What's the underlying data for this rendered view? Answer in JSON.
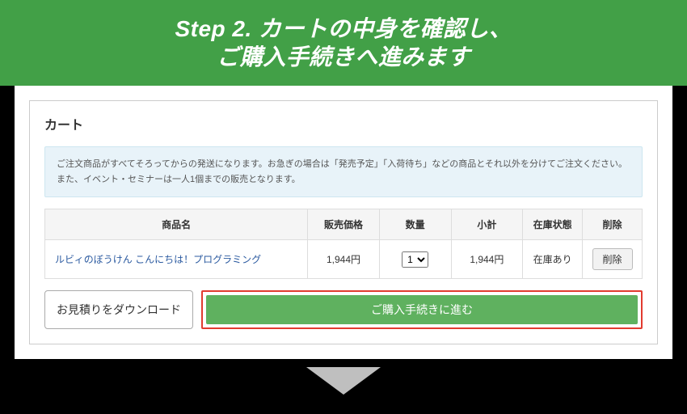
{
  "banner": {
    "line1": "Step 2. カートの中身を確認し、",
    "line2": "ご購入手続きへ進みます"
  },
  "cart": {
    "title": "カート",
    "notice_line1": "ご注文商品がすべてそろってからの発送になります。お急ぎの場合は「発売予定」「入荷待ち」などの商品とそれ以外を分けてご注文ください。",
    "notice_line2": "また、イベント・セミナーは一人1個までの販売となります。",
    "columns": {
      "name": "商品名",
      "price": "販売価格",
      "qty": "数量",
      "subtotal": "小計",
      "stock": "在庫状態",
      "delete": "削除"
    },
    "items": [
      {
        "name": "ルビィのぼうけん こんにちは！プログラミング",
        "price": "1,944円",
        "qty": "1",
        "subtotal": "1,944円",
        "stock": "在庫あり",
        "delete_label": "削除"
      }
    ],
    "quote_button": "お見積りをダウンロード",
    "proceed_button": "ご購入手続きに進む"
  }
}
